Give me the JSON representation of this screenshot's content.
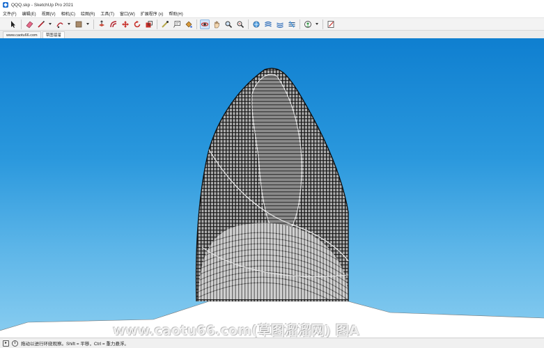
{
  "window": {
    "title": "QQQ.skp - SketchUp Pro 2021"
  },
  "menu": {
    "items": [
      "文件(F)",
      "编辑(E)",
      "视图(V)",
      "相机(C)",
      "绘图(R)",
      "工具(T)",
      "窗口(W)",
      "扩展程序 (x)",
      "帮助(H)"
    ]
  },
  "toolbar": {
    "tools": [
      {
        "icon": "select-arrow-icon"
      },
      {
        "icon": "eraser-icon"
      },
      {
        "icon": "pencil-line-icon"
      },
      {
        "icon": "arc-icon"
      },
      {
        "icon": "rectangle-shape-icon"
      },
      {
        "icon": "push-pull-icon"
      },
      {
        "icon": "offset-icon"
      },
      {
        "icon": "move-icon"
      },
      {
        "icon": "rotate-icon"
      },
      {
        "icon": "scale-icon"
      },
      {
        "icon": "tape-measure-icon"
      },
      {
        "icon": "text-label-icon"
      },
      {
        "icon": "paint-bucket-icon"
      },
      {
        "icon": "orbit-icon"
      },
      {
        "icon": "pan-hand-icon"
      },
      {
        "icon": "zoom-icon"
      },
      {
        "icon": "zoom-extents-icon"
      },
      {
        "icon": "warehouse-icon"
      },
      {
        "icon": "extension-warehouse-icon"
      },
      {
        "icon": "layout-icon"
      },
      {
        "icon": "extension-manager-icon"
      },
      {
        "icon": "profile-icon"
      },
      {
        "icon": "notes-icon"
      }
    ]
  },
  "tabs": [
    {
      "label": "www.caotu66.com"
    },
    {
      "label": "草图溜溜"
    }
  ],
  "viewport": {
    "watermark": "www.caotu66.com(草图溜溜网) 图A"
  },
  "status": {
    "message": "拖动以进行环绕观察。Shift = 平移，Ctrl = 重力悬浮。"
  },
  "colors": {
    "sky_top": "#0f7fd0",
    "sky_bottom": "#89cdf0",
    "building_grid": "#1a1a1a",
    "building_skin": "#d9d9d9",
    "ground": "#ffffff"
  }
}
